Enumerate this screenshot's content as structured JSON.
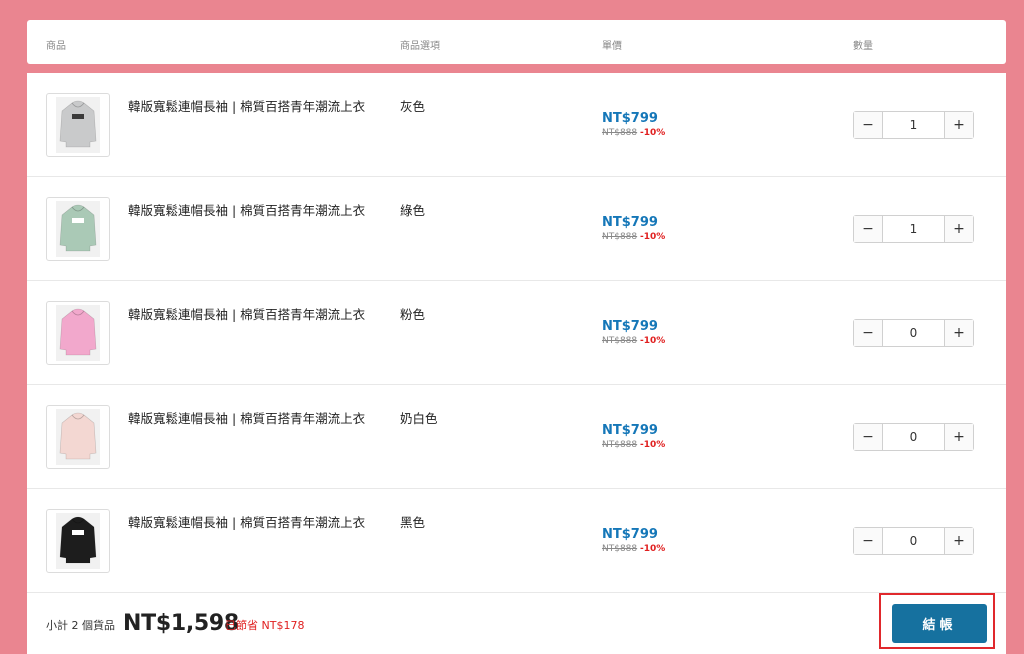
{
  "header": {
    "col_product": "商品",
    "col_option": "商品選項",
    "col_price": "單價",
    "col_qty": "數量"
  },
  "items": [
    {
      "name": "韓版寬鬆連帽長袖 | 棉質百搭青年潮流上衣",
      "option": "灰色",
      "price": "NT$799",
      "original_price": "NT$888",
      "discount": "-10%",
      "quantity": "1",
      "color": "#c9cacb",
      "print": "#3a3a3a"
    },
    {
      "name": "韓版寬鬆連帽長袖 | 棉質百搭青年潮流上衣",
      "option": "綠色",
      "price": "NT$799",
      "original_price": "NT$888",
      "discount": "-10%",
      "quantity": "1",
      "color": "#aac9b6",
      "print": "#ffffff"
    },
    {
      "name": "韓版寬鬆連帽長袖 | 棉質百搭青年潮流上衣",
      "option": "粉色",
      "price": "NT$799",
      "original_price": "NT$888",
      "discount": "-10%",
      "quantity": "0",
      "color": "#f2a8cc",
      "print": "#f2a8cc"
    },
    {
      "name": "韓版寬鬆連帽長袖 | 棉質百搭青年潮流上衣",
      "option": "奶白色",
      "price": "NT$799",
      "original_price": "NT$888",
      "discount": "-10%",
      "quantity": "0",
      "color": "#f3d7d2",
      "print": "#f3d7d2"
    },
    {
      "name": "韓版寬鬆連帽長袖 | 棉質百搭青年潮流上衣",
      "option": "黑色",
      "price": "NT$799",
      "original_price": "NT$888",
      "discount": "-10%",
      "quantity": "0",
      "color": "#1d1d1d",
      "print": "#ffffff"
    }
  ],
  "stepper": {
    "minus": "−",
    "plus": "+"
  },
  "footer": {
    "subtotal_label": "小計 2 個貨品",
    "subtotal_amount": "NT$1,598",
    "saved_text": "已節省 NT$178",
    "checkout_label": "結帳"
  },
  "colors": {
    "background": "#ea8590",
    "accent": "#16719f",
    "price": "#1577b8",
    "discount": "#e02020",
    "highlight_frame": "#e0282c"
  },
  "icons": {
    "product_thumbnail": "hoodie-icon"
  }
}
